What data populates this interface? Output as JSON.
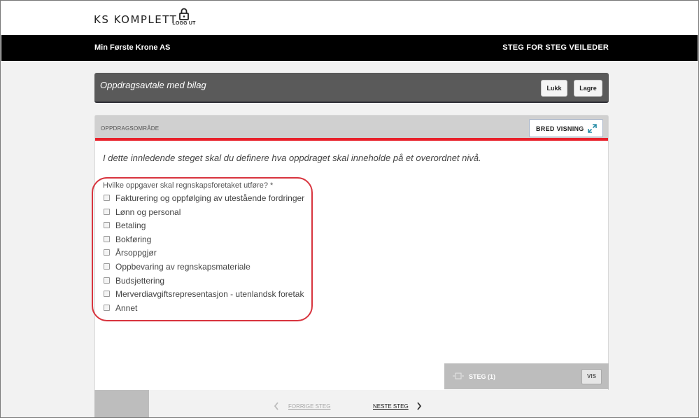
{
  "header": {
    "brand": "KS KOMPLETT",
    "logout_label": "LOGG UT"
  },
  "navbar": {
    "company": "Min Første Krone AS",
    "guide_link": "STEG FOR STEG VEILEDER"
  },
  "document": {
    "title": "Oppdragsavtale med bilag",
    "close_label": "Lukk",
    "save_label": "Lagre"
  },
  "section": {
    "title": "OPPDRAGSOMRÅDE",
    "wide_view_label": "BRED VISNING",
    "intro": "I dette innledende steget skal du definere hva oppdraget skal inneholde på et overordnet nivå.",
    "question": "Hvilke oppgaver skal regnskapsforetaket utføre? *",
    "options": [
      {
        "label": "Fakturering og oppfølging av utestående fordringer",
        "checked": false
      },
      {
        "label": "Lønn og personal",
        "checked": false
      },
      {
        "label": "Betaling",
        "checked": false
      },
      {
        "label": "Bokføring",
        "checked": false
      },
      {
        "label": "Årsoppgjør",
        "checked": false
      },
      {
        "label": "Oppbevaring av regnskapsmateriale",
        "checked": false
      },
      {
        "label": "Budsjettering",
        "checked": false
      },
      {
        "label": "Merverdiavgiftsrepresentasjon - utenlandsk foretak",
        "checked": false
      },
      {
        "label": "Annet",
        "checked": false
      }
    ]
  },
  "steps": {
    "label": "STEG (1)",
    "show_label": "VIS"
  },
  "pager": {
    "prev_label": "FORRIGE STEG",
    "next_label": "NESTE STEG"
  },
  "colors": {
    "accent_red": "#e8202a",
    "header_black": "#000000",
    "doc_bar": "#5a5a5a"
  }
}
